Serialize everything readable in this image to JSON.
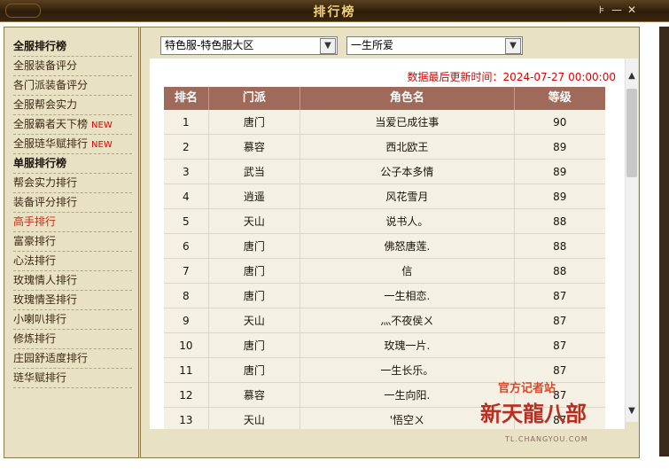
{
  "window": {
    "title": "排行榜",
    "pin_icon": "pin-icon",
    "minimize_icon": "minimize-icon",
    "close_icon": "close-icon"
  },
  "sidebar": {
    "items": [
      {
        "label": "全服排行榜",
        "type": "header"
      },
      {
        "label": "全服装备评分"
      },
      {
        "label": "各门派装备评分"
      },
      {
        "label": "全服帮会实力"
      },
      {
        "label": "全服霸者天下榜",
        "badge": "NEW"
      },
      {
        "label": "全服琏华赋排行",
        "badge": "NEW"
      },
      {
        "label": "单服排行榜",
        "type": "header"
      },
      {
        "label": "帮会实力排行"
      },
      {
        "label": "装备评分排行"
      },
      {
        "label": "高手排行",
        "active": true
      },
      {
        "label": "富豪排行"
      },
      {
        "label": "心法排行"
      },
      {
        "label": "玫瑰情人排行"
      },
      {
        "label": "玫瑰情圣排行"
      },
      {
        "label": "小喇叭排行"
      },
      {
        "label": "修炼排行"
      },
      {
        "label": "庄园舒适度排行"
      },
      {
        "label": "琏华赋排行"
      }
    ]
  },
  "filters": {
    "server": "特色服-特色服大区",
    "category": "一生所爱"
  },
  "update_text": "数据最后更新时间：2024-07-27 00:00:00",
  "table": {
    "headers": [
      "排名",
      "门派",
      "角色名",
      "等级"
    ],
    "rows": [
      [
        "1",
        "唐门",
        "当爱已成往事",
        "90"
      ],
      [
        "2",
        "慕容",
        "西北欧王",
        "89"
      ],
      [
        "3",
        "武当",
        "公子本多情",
        "89"
      ],
      [
        "4",
        "逍遥",
        "风花雪月",
        "89"
      ],
      [
        "5",
        "天山",
        "说书人。",
        "88"
      ],
      [
        "6",
        "唐门",
        "佛怒唐莲.",
        "88"
      ],
      [
        "7",
        "唐门",
        "信",
        "88"
      ],
      [
        "8",
        "唐门",
        "一生相恋.",
        "87"
      ],
      [
        "9",
        "天山",
        "灬不夜侯ㄨ",
        "87"
      ],
      [
        "10",
        "唐门",
        "玫瑰一片.",
        "87"
      ],
      [
        "11",
        "唐门",
        "一生长乐。",
        "87"
      ],
      [
        "12",
        "慕容",
        "一生向阳.",
        "87"
      ],
      [
        "13",
        "天山",
        "'悟空ㄨ",
        "87"
      ]
    ]
  },
  "logo": {
    "line1": "官方记者站",
    "line2": "新天龍八部",
    "line3": "TL.CHANGYOU.COM"
  }
}
